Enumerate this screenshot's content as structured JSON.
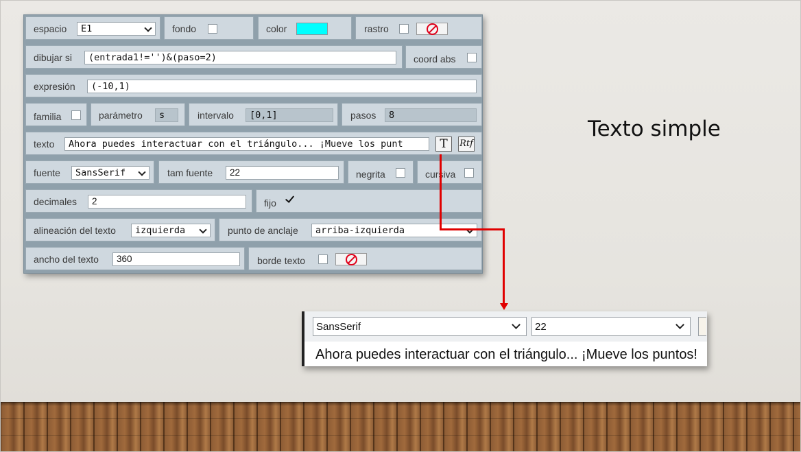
{
  "slide": {
    "title": "Texto simple"
  },
  "editor": {
    "espacio": {
      "label": "espacio",
      "value": "E1"
    },
    "fondo": {
      "label": "fondo",
      "checked": false
    },
    "color": {
      "label": "color",
      "value": "#00ffff"
    },
    "rastro": {
      "label": "rastro",
      "checked": false
    },
    "dibujar_si": {
      "label": "dibujar si",
      "value": "(entrada1!='')&(paso=2)"
    },
    "coord_abs": {
      "label": "coord abs",
      "checked": false
    },
    "expresion": {
      "label": "expresión",
      "value": "(-10,1)"
    },
    "familia": {
      "label": "familia",
      "checked": false
    },
    "parametro": {
      "label": "parámetro",
      "value": "s"
    },
    "intervalo": {
      "label": "intervalo",
      "value": "[0,1]"
    },
    "pasos": {
      "label": "pasos",
      "value": "8"
    },
    "texto": {
      "label": "texto",
      "value": "Ahora puedes interactuar con el triángulo... ¡Mueve los punt",
      "btn_text": "T",
      "btn_rtf": "Rtf"
    },
    "fuente": {
      "label": "fuente",
      "value": "SansSerif"
    },
    "tam_fuente": {
      "label": "tam fuente",
      "value": "22"
    },
    "negrita": {
      "label": "negrita",
      "checked": false
    },
    "cursiva": {
      "label": "cursiva",
      "checked": false
    },
    "decimales": {
      "label": "decimales",
      "value": "2"
    },
    "fijo": {
      "label": "fijo",
      "checked": true
    },
    "alineacion": {
      "label": "alineación del texto",
      "value": "izquierda"
    },
    "punto_anclaje": {
      "label": "punto de anclaje",
      "value": "arriba-izquierda"
    },
    "ancho_texto": {
      "label": "ancho del texto",
      "value": "360"
    },
    "borde_texto": {
      "label": "borde texto",
      "checked": false
    }
  },
  "zoom": {
    "font_select": "SansSerif",
    "size_select": "22",
    "text": "Ahora puedes interactuar con el triángulo... ¡Mueve los puntos!"
  },
  "icons": [
    "no-color-icon",
    "dropdown-chevron-icon",
    "checkmark-icon",
    "text-editor-icon",
    "rtf-editor-icon",
    "arrow-down-icon"
  ]
}
